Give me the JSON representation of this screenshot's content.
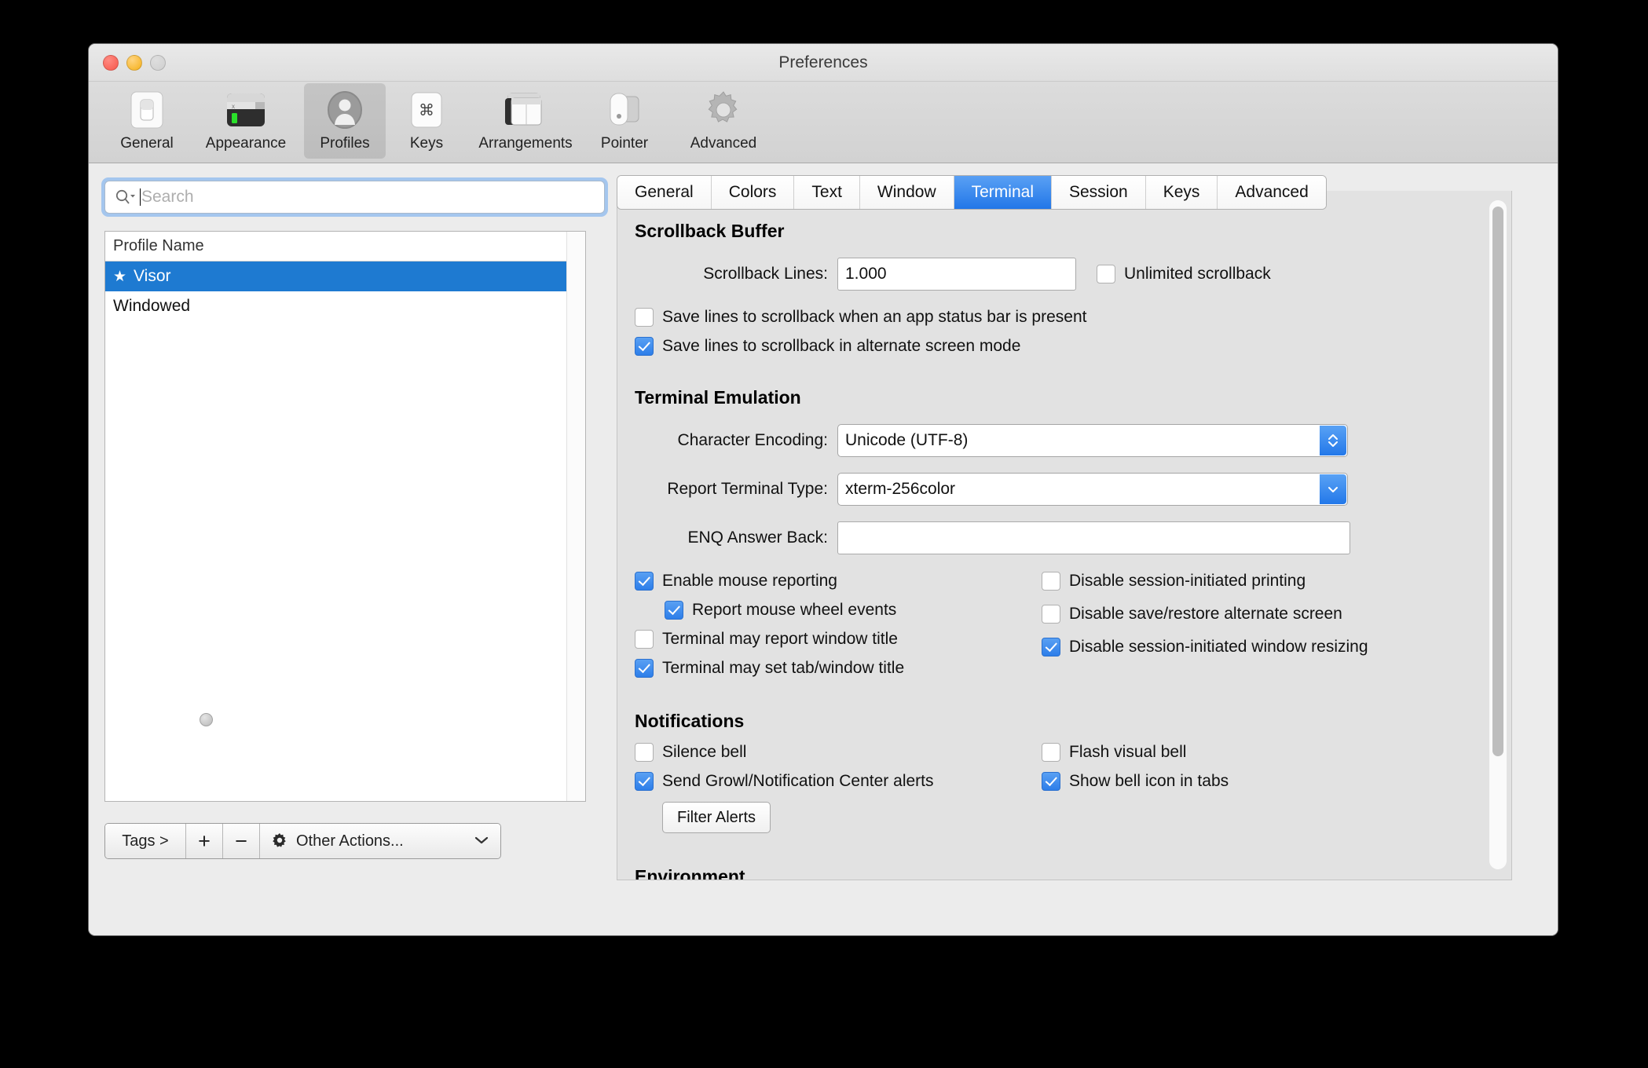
{
  "window": {
    "title": "Preferences",
    "traffic_lights": [
      "close-button",
      "minimize-button",
      "zoom-button"
    ]
  },
  "toolbar": {
    "items": [
      {
        "label": "General",
        "icon": "switch-icon",
        "selected": false
      },
      {
        "label": "Appearance",
        "icon": "terminal-icon",
        "selected": false
      },
      {
        "label": "Profiles",
        "icon": "person-icon",
        "selected": true
      },
      {
        "label": "Keys",
        "icon": "command-key-icon",
        "selected": false
      },
      {
        "label": "Arrangements",
        "icon": "windows-icon",
        "selected": false
      },
      {
        "label": "Pointer",
        "icon": "mouse-icon",
        "selected": false
      },
      {
        "label": "Advanced",
        "icon": "gear-icon",
        "selected": false
      }
    ]
  },
  "sidebar": {
    "search": {
      "placeholder": "Search",
      "value": ""
    },
    "list": {
      "header": "Profile Name",
      "rows": [
        {
          "name": "Visor",
          "starred": true,
          "star": "★",
          "selected": true
        },
        {
          "name": "Windowed",
          "starred": false,
          "star": "",
          "selected": false
        }
      ]
    },
    "bottom_bar": {
      "tags_label": "Tags >",
      "add_label": "+",
      "remove_label": "−",
      "other_actions_label": "Other Actions...",
      "other_actions_chevron": "⌄"
    }
  },
  "tabs": [
    {
      "label": "General",
      "selected": false
    },
    {
      "label": "Colors",
      "selected": false
    },
    {
      "label": "Text",
      "selected": false
    },
    {
      "label": "Window",
      "selected": false
    },
    {
      "label": "Terminal",
      "selected": true
    },
    {
      "label": "Session",
      "selected": false
    },
    {
      "label": "Keys",
      "selected": false
    },
    {
      "label": "Advanced",
      "selected": false
    }
  ],
  "panel": {
    "scrollback": {
      "title": "Scrollback Buffer",
      "lines_label": "Scrollback Lines:",
      "lines_value": "1.000",
      "unlimited_label": "Unlimited scrollback",
      "unlimited_checked": false,
      "save_status_bar_label": "Save lines to scrollback when an app status bar is present",
      "save_status_bar_checked": false,
      "save_alt_screen_label": "Save lines to scrollback in alternate screen mode",
      "save_alt_screen_checked": true
    },
    "emulation": {
      "title": "Terminal Emulation",
      "encoding_label": "Character Encoding:",
      "encoding_value": "Unicode (UTF-8)",
      "terminal_type_label": "Report Terminal Type:",
      "terminal_type_value": "xterm-256color",
      "enq_label": "ENQ Answer Back:",
      "enq_value": "",
      "options_left": [
        {
          "label": "Enable mouse reporting",
          "checked": true,
          "indented": false
        },
        {
          "label": "Report mouse wheel events",
          "checked": true,
          "indented": true
        },
        {
          "label": "Terminal may report window title",
          "checked": false,
          "indented": false
        },
        {
          "label": "Terminal may set tab/window title",
          "checked": true,
          "indented": false
        }
      ],
      "options_right": [
        {
          "label": "Disable session-initiated printing",
          "checked": false
        },
        {
          "label": "Disable save/restore alternate screen",
          "checked": false
        },
        {
          "label": "Disable session-initiated window resizing",
          "checked": true
        }
      ]
    },
    "notifications": {
      "title": "Notifications",
      "options_left": [
        {
          "label": "Silence bell",
          "checked": false
        },
        {
          "label": "Send Growl/Notification Center alerts",
          "checked": true
        }
      ],
      "options_right": [
        {
          "label": "Flash visual bell",
          "checked": false
        },
        {
          "label": "Show bell icon in tabs",
          "checked": true
        }
      ],
      "filter_alerts_label": "Filter Alerts"
    },
    "environment": {
      "title": "Environment"
    }
  },
  "colors": {
    "accent_blue": "#2277e8",
    "selection_blue": "#1e7ad1",
    "window_bg": "#ececec",
    "panel_bg": "#e2e2e2"
  }
}
